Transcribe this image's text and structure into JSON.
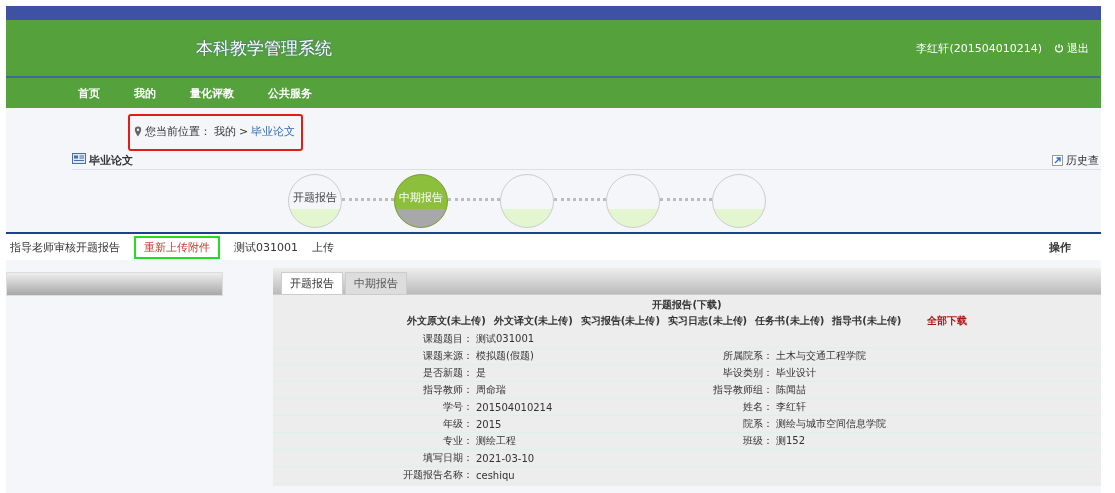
{
  "header": {
    "title": "本科教学管理系统",
    "user": "李红轩(201504010214)",
    "logout": "退出"
  },
  "nav": [
    {
      "label": "首页"
    },
    {
      "label": "我的"
    },
    {
      "label": "量化评教"
    },
    {
      "label": "公共服务"
    }
  ],
  "breadcrumb": {
    "prefix": "您当前位置：",
    "items": [
      {
        "label": "我的",
        "selected": false
      },
      {
        "label": "毕业论文",
        "selected": true
      }
    ],
    "separator": ">",
    "highlighted": true
  },
  "section": {
    "title": "毕业论文",
    "history": "历史查"
  },
  "steps": [
    {
      "label": "开题报告",
      "selected": false
    },
    {
      "label": "中期报告",
      "selected": true
    },
    {
      "selected": false
    },
    {
      "selected": false
    },
    {
      "selected": false
    }
  ],
  "task_row": {
    "status": "指导老师审核开题报告",
    "action": "重新上传附件",
    "cells": [
      "测试031001",
      "上传"
    ],
    "operation_header": "操作"
  },
  "tabs": [
    {
      "label": "开题报告",
      "selected": true
    },
    {
      "label": "中期报告",
      "selected": false
    }
  ],
  "report": {
    "title": "开题报告(下载)",
    "files": [
      {
        "label": "外文原文(未上传)",
        "kind": "file"
      },
      {
        "label": "外文译文(未上传)",
        "kind": "file"
      },
      {
        "label": "实习报告(未上传)",
        "kind": "file"
      },
      {
        "label": "实习日志(未上传)",
        "kind": "file"
      },
      {
        "label": "任务书(未上传)",
        "kind": "file"
      },
      {
        "label": "指导书(未上传)",
        "kind": "file"
      },
      {
        "label": "全部下载",
        "kind": "all"
      }
    ],
    "fields": [
      [
        {
          "label": "课题题目：",
          "value": "测试031001"
        }
      ],
      [
        {
          "label": "课题来源：",
          "value": "模拟题(假题)"
        },
        {
          "label": "所属院系：",
          "value": "土木与交通工程学院"
        }
      ],
      [
        {
          "label": "是否新题：",
          "value": "是"
        },
        {
          "label": "毕设类别：",
          "value": "毕业设计"
        }
      ],
      [
        {
          "label": "指导教师：",
          "value": "周命瑞"
        },
        {
          "label": "指导教师组：",
          "value": "陈闻喆"
        }
      ],
      [
        {
          "label": "学号：",
          "value": "201504010214"
        },
        {
          "label": "姓名：",
          "value": "李红轩"
        }
      ],
      [
        {
          "label": "年级：",
          "value": "2015"
        },
        {
          "label": "院系：",
          "value": "测绘与城市空间信息学院"
        }
      ],
      [
        {
          "label": "专业：",
          "value": "测绘工程"
        },
        {
          "label": "班级：",
          "value": "测152"
        }
      ],
      [
        {
          "label": "填写日期：",
          "value": "2021-03-10"
        }
      ],
      [
        {
          "label": "开题报告名称：",
          "value": "ceshiqu"
        }
      ]
    ]
  }
}
